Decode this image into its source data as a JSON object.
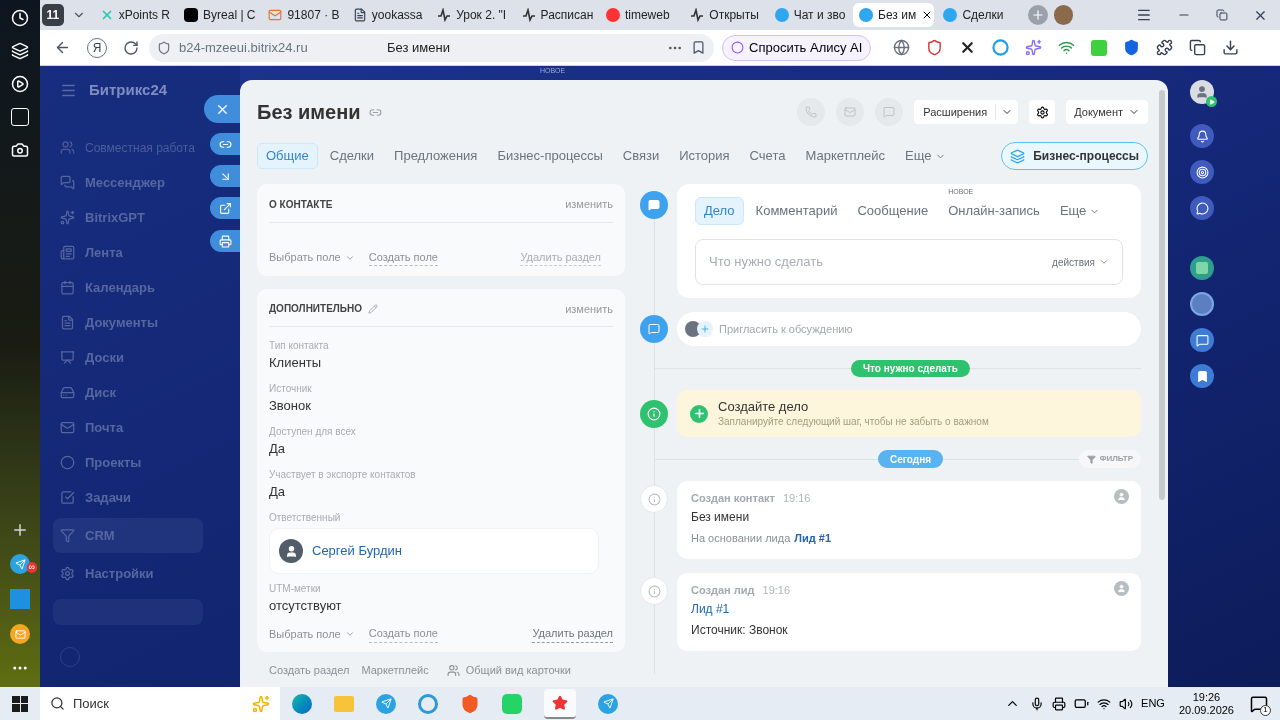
{
  "browser": {
    "telegram_badge": "∞",
    "tab_group": "11",
    "tabs": [
      {
        "kind": "x",
        "title": "xPoints R",
        "selected": false
      },
      {
        "kind": "r",
        "title": "Byreal | C",
        "selected": false
      },
      {
        "kind": "mail",
        "title": "91807 · B",
        "selected": false
      },
      {
        "kind": "doc",
        "title": "yookassa",
        "selected": false
      },
      {
        "kind": "pulse",
        "title": "Урок 2. \"I",
        "selected": false
      },
      {
        "kind": "pulse",
        "title": "Расписан",
        "selected": false
      },
      {
        "kind": "ya",
        "title": "timeweb",
        "selected": false
      },
      {
        "kind": "pulse",
        "title": "Открыты",
        "selected": false
      },
      {
        "kind": "b24",
        "title": "Чат и зво",
        "selected": false
      },
      {
        "kind": "b24",
        "title": "Без им",
        "selected": true
      },
      {
        "kind": "b24",
        "title": "Сделки",
        "selected": false
      }
    ],
    "address": {
      "yandex_button": "Я",
      "url": "b24-mzeeui.bitrix24.ru",
      "page_title": "Без имени",
      "alice": "Спросить Алису AI"
    }
  },
  "bitrix": {
    "logo": "Битрикс24",
    "top_badge": "НОВОЕ",
    "menu": [
      {
        "kind": "header",
        "label": "Совместная работа",
        "selected": false
      },
      {
        "kind": "item",
        "label": "Мессенджер",
        "selected": false
      },
      {
        "kind": "item",
        "label": "BitrixGPT",
        "selected": false
      },
      {
        "kind": "item",
        "label": "Лента",
        "selected": false
      },
      {
        "kind": "item",
        "label": "Календарь",
        "selected": false
      },
      {
        "kind": "item",
        "label": "Документы",
        "selected": false
      },
      {
        "kind": "item",
        "label": "Доски",
        "selected": false
      },
      {
        "kind": "item",
        "label": "Диск",
        "selected": false
      },
      {
        "kind": "item",
        "label": "Почта",
        "selected": false
      },
      {
        "kind": "item",
        "label": "Проекты",
        "selected": false
      },
      {
        "kind": "item",
        "label": "Задачи",
        "selected": false
      },
      {
        "kind": "item",
        "label": "CRM",
        "selected": true
      },
      {
        "kind": "item",
        "label": "Настройки",
        "selected": false
      }
    ]
  },
  "card": {
    "title": "Без имени",
    "call_disabled": true,
    "mail_disabled": true,
    "chat_disabled": true,
    "extensions": "Расширения",
    "document": "Документ",
    "tabs": [
      {
        "label": "Общие",
        "selected": true
      },
      {
        "label": "Сделки",
        "selected": false
      },
      {
        "label": "Предложения",
        "selected": false
      },
      {
        "label": "Бизнес-процессы",
        "selected": false
      },
      {
        "label": "Связи",
        "selected": false
      },
      {
        "label": "История",
        "selected": false
      },
      {
        "label": "Счета",
        "selected": false
      },
      {
        "label": "Маркетплейс",
        "selected": false
      },
      {
        "label": "Еще",
        "selected": false
      }
    ],
    "bp_button": "Бизнес-процессы",
    "sections": [
      {
        "title": "О КОНТАКТЕ",
        "title_editable": false,
        "edit": "изменить",
        "select": "Выбрать поле",
        "create": "Создать поле",
        "delete": "Удалить раздел",
        "delete_disabled": true
      },
      {
        "title": "ДОПОЛНИТЕЛЬНО",
        "title_editable": true,
        "edit": "изменить",
        "fields": [
          {
            "kind": "text",
            "label": "Тип контакта",
            "value": "Клиенты"
          },
          {
            "kind": "text",
            "label": "Источник",
            "value": "Звонок"
          },
          {
            "kind": "text",
            "label": "Доступен для всех",
            "value": "Да"
          },
          {
            "kind": "text",
            "label": "Участвует в экспорте контактов",
            "value": "Да"
          },
          {
            "kind": "user",
            "label": "Ответственный",
            "value": "Сергей Бурдин"
          },
          {
            "kind": "text",
            "label": "UTM-метки",
            "value": "отсутствуют"
          }
        ],
        "select": "Выбрать поле",
        "create": "Создать поле",
        "delete": "Удалить раздел",
        "delete_disabled": false
      }
    ],
    "footer_links": [
      {
        "kind": "plain",
        "label": "Создать раздел"
      },
      {
        "kind": "plain",
        "label": "Маркетплейс"
      },
      {
        "kind": "view",
        "label": "Общий вид карточки"
      }
    ],
    "timeline": {
      "composer_tabs": [
        {
          "label": "Дело",
          "selected": true
        },
        {
          "label": "Комментарий",
          "selected": false
        },
        {
          "label": "Сообщение",
          "selected": false
        },
        {
          "label": "Онлайн-запись",
          "badge": "НОВОЕ",
          "selected": false
        },
        {
          "label": "Еще",
          "selected": false
        }
      ],
      "placeholder": "Что нужно сделать",
      "actions": "действия",
      "invite": "Пригласить к обсуждению",
      "todo_label": "Что нужно сделать",
      "tip_title": "Создайте дело",
      "tip_text": "Запланируйте следующий шаг, чтобы не забыть о важном",
      "date_label": "Сегодня",
      "filter": "ФИЛЬТР",
      "events": [
        {
          "title": "Создан контакт",
          "time": "19:16",
          "lines": [
            {
              "kind": "text",
              "text": "Без имени"
            },
            {
              "kind": "note",
              "text": "На основании лида",
              "link": "Лид #1"
            }
          ]
        },
        {
          "title": "Создан лид",
          "time": "19:16",
          "lines": [
            {
              "kind": "link",
              "text": "Лид #1"
            },
            {
              "kind": "text",
              "text": "Источник: Звонок"
            }
          ]
        }
      ]
    }
  },
  "taskbar": {
    "search": "Поиск",
    "language": "ENG",
    "time": "19:26",
    "date": "20.09.2026",
    "notifications": "1"
  }
}
